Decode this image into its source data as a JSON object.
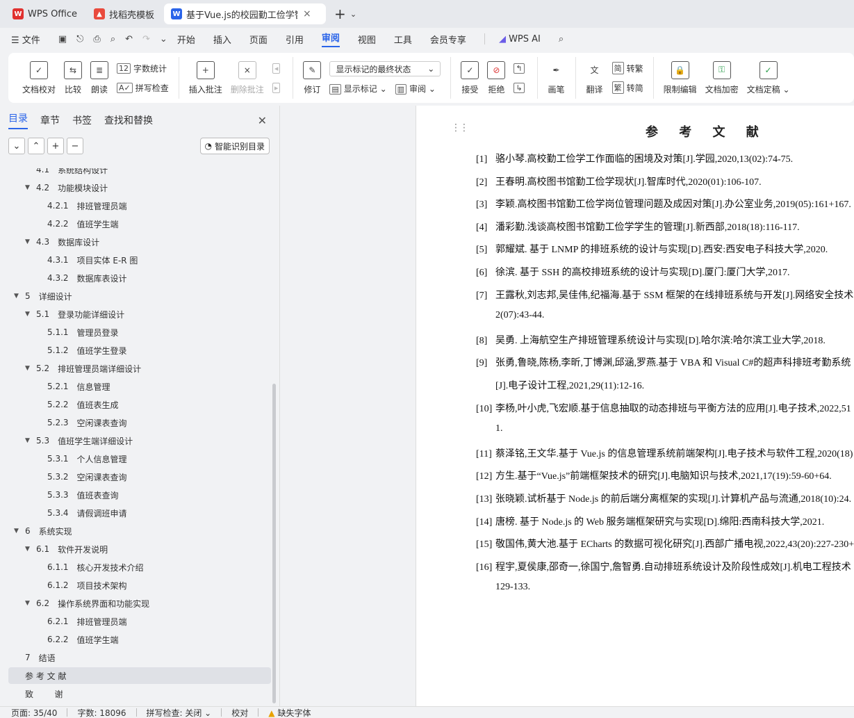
{
  "tabs": [
    {
      "label": "WPS Office",
      "icon": "wps-logo-icon"
    },
    {
      "label": "找稻壳模板",
      "icon": "docer-icon"
    },
    {
      "label": "基于Vue.js的校园勤工俭学智能",
      "icon": "word-doc-icon"
    }
  ],
  "menu": {
    "file": "文件",
    "items": [
      "开始",
      "插入",
      "页面",
      "引用",
      "审阅",
      "视图",
      "工具",
      "会员专享"
    ],
    "active": "审阅",
    "wps_ai": "WPS AI"
  },
  "ribbon": {
    "doc_check": "文档校对",
    "compare": "比较",
    "read_aloud": "朗读",
    "word_count": "字数统计",
    "spell_check": "拼写检查",
    "insert_comment": "插入批注",
    "delete_comment": "删除批注",
    "revise": "修订",
    "markup_state": "显示标记的最终状态",
    "show_markup": "显示标记",
    "review_pane": "审阅",
    "accept": "接受",
    "reject": "拒绝",
    "pen": "画笔",
    "translate": "翻译",
    "to_traditional": "转繁",
    "to_simplified": "转简",
    "restrict_edit": "限制编辑",
    "encrypt": "文档加密",
    "finalize": "文档定稿"
  },
  "left_panel": {
    "tabs": [
      "目录",
      "章节",
      "书签",
      "查找和替换"
    ],
    "smart_toc": "智能识别目录",
    "toc": [
      {
        "num": "4.1",
        "title": "系统结构设计",
        "level": 2,
        "arrow": ""
      },
      {
        "num": "4.2",
        "title": "功能模块设计",
        "level": 2,
        "arrow": "▼"
      },
      {
        "num": "4.2.1",
        "title": "排班管理员端",
        "level": 3,
        "arrow": ""
      },
      {
        "num": "4.2.2",
        "title": "值班学生端",
        "level": 3,
        "arrow": ""
      },
      {
        "num": "4.3",
        "title": "数据库设计",
        "level": 2,
        "arrow": "▼"
      },
      {
        "num": "4.3.1",
        "title": "项目实体 E-R 图",
        "level": 3,
        "arrow": ""
      },
      {
        "num": "4.3.2",
        "title": "数据库表设计",
        "level": 3,
        "arrow": ""
      },
      {
        "num": "5",
        "title": "详细设计",
        "level": 1,
        "arrow": "▼"
      },
      {
        "num": "5.1",
        "title": "登录功能详细设计",
        "level": 2,
        "arrow": "▼"
      },
      {
        "num": "5.1.1",
        "title": "管理员登录",
        "level": 3,
        "arrow": ""
      },
      {
        "num": "5.1.2",
        "title": "值班学生登录",
        "level": 3,
        "arrow": ""
      },
      {
        "num": "5.2",
        "title": "排班管理员端详细设计",
        "level": 2,
        "arrow": "▼"
      },
      {
        "num": "5.2.1",
        "title": "信息管理",
        "level": 3,
        "arrow": ""
      },
      {
        "num": "5.2.2",
        "title": "值班表生成",
        "level": 3,
        "arrow": ""
      },
      {
        "num": "5.2.3",
        "title": "空闲课表查询",
        "level": 3,
        "arrow": ""
      },
      {
        "num": "5.3",
        "title": "值班学生端详细设计",
        "level": 2,
        "arrow": "▼"
      },
      {
        "num": "5.3.1",
        "title": "个人信息管理",
        "level": 3,
        "arrow": ""
      },
      {
        "num": "5.3.2",
        "title": "空闲课表查询",
        "level": 3,
        "arrow": ""
      },
      {
        "num": "5.3.3",
        "title": "值班表查询",
        "level": 3,
        "arrow": ""
      },
      {
        "num": "5.3.4",
        "title": "请假调班申请",
        "level": 3,
        "arrow": ""
      },
      {
        "num": "6",
        "title": "系统实现",
        "level": 1,
        "arrow": "▼"
      },
      {
        "num": "6.1",
        "title": "软件开发说明",
        "level": 2,
        "arrow": "▼"
      },
      {
        "num": "6.1.1",
        "title": "核心开发技术介绍",
        "level": 3,
        "arrow": ""
      },
      {
        "num": "6.1.2",
        "title": "项目技术架构",
        "level": 3,
        "arrow": ""
      },
      {
        "num": "6.2",
        "title": "操作系统界面和功能实现",
        "level": 2,
        "arrow": "▼"
      },
      {
        "num": "6.2.1",
        "title": "排班管理员端",
        "level": 3,
        "arrow": ""
      },
      {
        "num": "6.2.2",
        "title": "值班学生端",
        "level": 3,
        "arrow": ""
      },
      {
        "num": "7",
        "title": "结语",
        "level": 1,
        "arrow": ""
      },
      {
        "num": "",
        "title": "参 考 文 献",
        "level": 1,
        "arrow": "",
        "selected": true
      },
      {
        "num": "",
        "title": "致        谢",
        "level": 1,
        "arrow": ""
      }
    ]
  },
  "document": {
    "heading": "参 考 文 献",
    "references": [
      {
        "n": "[1]",
        "lines": [
          "骆小琴.高校勤工俭学工作面临的困境及对策[J].学园,2020,13(02):74-75."
        ]
      },
      {
        "n": "[2]",
        "lines": [
          "王春明.高校图书馆勤工俭学现状[J].智库时代,2020(01):106-107."
        ]
      },
      {
        "n": "[3]",
        "lines": [
          "李颖.高校图书馆勤工俭学岗位管理问题及成因对策[J].办公室业务,2019(05):161+167."
        ]
      },
      {
        "n": "[4]",
        "lines": [
          "潘彩勤.浅谈高校图书馆勤工俭学学生的管理[J].新西部,2018(18):116-117."
        ]
      },
      {
        "n": "[5]",
        "lines": [
          "郭耀斌. 基于 LNMP 的排班系统的设计与实现[D].西安:西安电子科技大学,2020."
        ]
      },
      {
        "n": "[6]",
        "lines": [
          "徐滨. 基于 SSH 的高校排班系统的设计与实现[D].厦门:厦门大学,2017."
        ]
      },
      {
        "n": "[7]",
        "lines": [
          "王露秋,刘志邦,吴佳伟,纪福海.基于 SSM 框架的在线排班系统与开发[J].网络安全技术",
          "2(07):43-44."
        ]
      },
      {
        "n": "[8]",
        "lines": [
          "吴勇. 上海航空生产排班管理系统设计与实现[D].哈尔滨:哈尔滨工业大学,2018."
        ]
      },
      {
        "n": "[9]",
        "lines": [
          "张勇,鲁晓,陈杨,李昕,丁博渊,邱涵,罗燕.基于 VBA 和 Visual  C#的超声科排班考勤系统",
          "[J].电子设计工程,2021,29(11):12-16."
        ]
      },
      {
        "n": "[10]",
        "lines": [
          "李杨,叶小虎,飞宏顺.基于信息抽取的动态排班与平衡方法的应用[J].电子技术,2022,51",
          "1."
        ]
      },
      {
        "n": "[11]",
        "lines": [
          "蔡泽铭,王文华.基于 Vue.js 的信息管理系统前端架构[J].电子技术与软件工程,2020(18)"
        ]
      },
      {
        "n": "[12]",
        "lines": [
          "方生.基于“Vue.js”前端框架技术的研究[J].电脑知识与技术,2021,17(19):59-60+64."
        ]
      },
      {
        "n": "[13]",
        "lines": [
          "张晓颖.试析基于 Node.js 的前后端分离框架的实现[J].计算机产品与流通,2018(10):24."
        ]
      },
      {
        "n": "[14]",
        "lines": [
          "唐榜. 基于 Node.js 的 Web 服务端框架研究与实现[D].绵阳:西南科技大学,2021."
        ]
      },
      {
        "n": "[15]",
        "lines": [
          "敬国伟,黄大池.基于 ECharts 的数据可视化研究[J].西部广播电视,2022,43(20):227-230+"
        ]
      },
      {
        "n": "[16]",
        "lines": [
          "程宇,夏侯康,邵奇一,徐国宁,詹智勇.自动排班系统设计及阶段性成效[J].机电工程技术",
          "129-133."
        ]
      }
    ]
  },
  "status": {
    "page": "页面: 35/40",
    "words": "字数: 18096",
    "spell": "拼写检查: 关闭",
    "proof": "校对",
    "missing_font": "缺失字体"
  },
  "colors": {
    "accent": "#2a64e9",
    "wps_red": "#e0312f"
  }
}
